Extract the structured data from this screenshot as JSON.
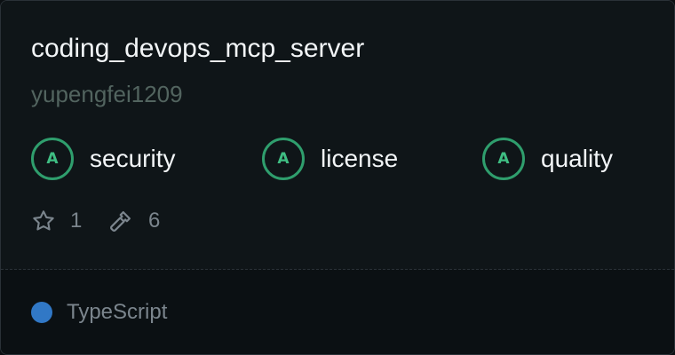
{
  "repo": {
    "name": "coding_devops_mcp_server",
    "owner": "yupengfei1209"
  },
  "badges": [
    {
      "grade": "A",
      "label": "security"
    },
    {
      "grade": "A",
      "label": "license"
    },
    {
      "grade": "A",
      "label": "quality"
    }
  ],
  "stats": {
    "stars": "1",
    "tools": "6"
  },
  "language": {
    "name": "TypeScript",
    "color": "#3178c6"
  },
  "colors": {
    "grade_ring": "#2f9e6d",
    "grade_text": "#3fbe83"
  },
  "icons": {
    "stars": "star-icon",
    "tools": "hammer-icon"
  }
}
